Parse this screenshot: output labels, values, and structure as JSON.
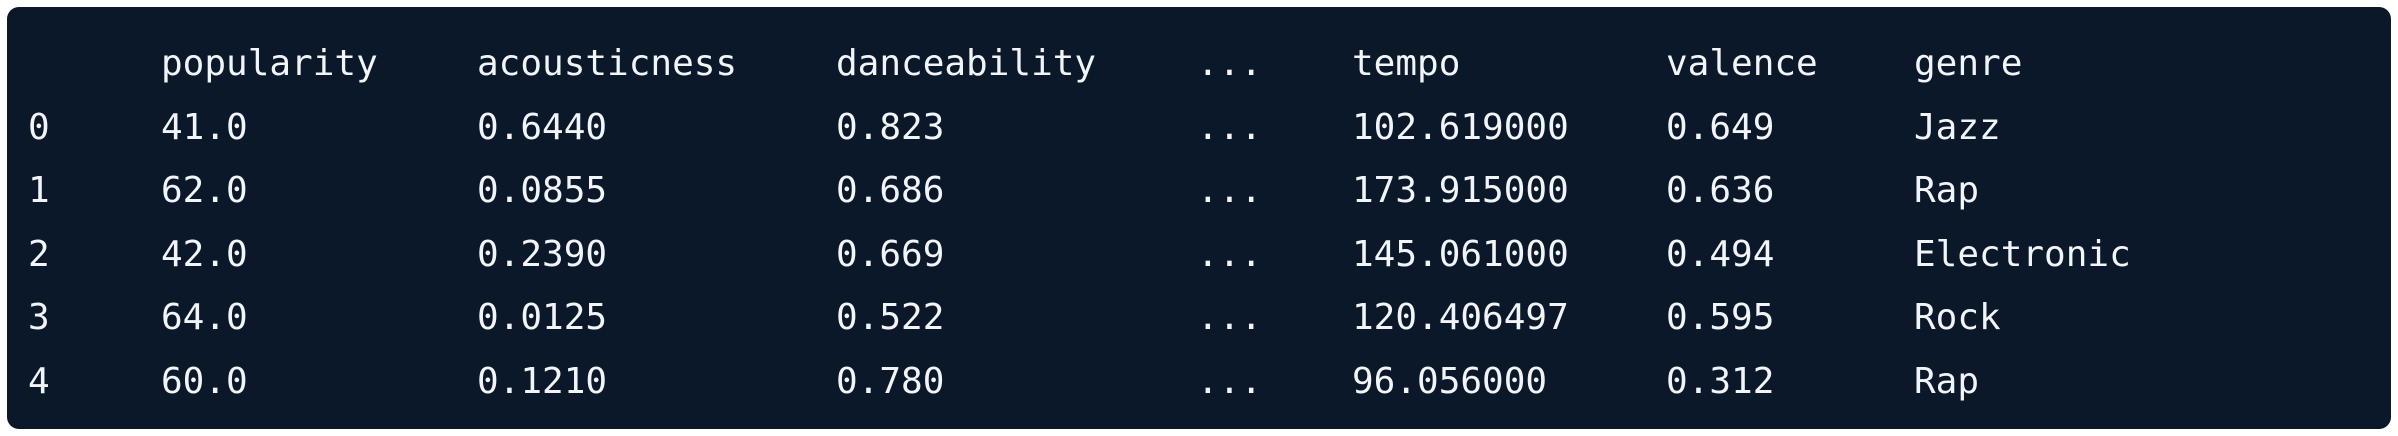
{
  "table": {
    "headers": [
      "",
      "popularity",
      "acousticness",
      "danceability",
      "...",
      "tempo",
      "valence",
      "genre"
    ],
    "rows": [
      [
        "0",
        "41.0",
        "0.6440",
        "0.823",
        "...",
        "102.619000",
        "0.649",
        "Jazz"
      ],
      [
        "1",
        "62.0",
        "0.0855",
        "0.686",
        "...",
        "173.915000",
        "0.636",
        "Rap"
      ],
      [
        "2",
        "42.0",
        "0.2390",
        "0.669",
        "...",
        "145.061000",
        "0.494",
        "Electronic"
      ],
      [
        "3",
        "64.0",
        "0.0125",
        "0.522",
        "...",
        "120.406497",
        "0.595",
        "Rock"
      ],
      [
        "4",
        "60.0",
        "0.1210",
        "0.780",
        "...",
        "96.056000",
        "0.312",
        "Rap"
      ]
    ]
  },
  "colors": {
    "background": "#0b1829",
    "text": "#f1f4f8"
  }
}
